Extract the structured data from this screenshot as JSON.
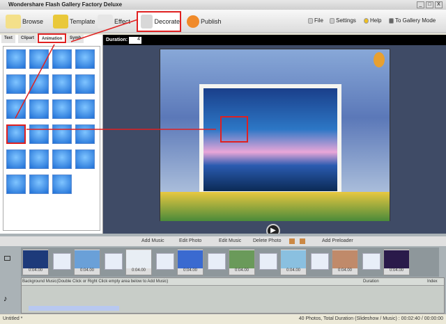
{
  "window": {
    "title": "Wondershare Flash Gallery Factory Deluxe",
    "min": "_",
    "max": "□",
    "close": "X"
  },
  "toolbar": {
    "browse": "Browse",
    "template": "Template",
    "effect": "Effect",
    "decorate": "Decorate",
    "publish": "Publish",
    "file": "File",
    "settings": "Settings",
    "help": "Help",
    "gallery": "To Gallery Mode"
  },
  "left_tabs": [
    "Text",
    "Clipart",
    "Animation",
    "Symb"
  ],
  "animation_count": 23,
  "duration": {
    "label": "Duration:",
    "value": "4"
  },
  "bottom_toolbar": {
    "add_music": "Add Music",
    "edit_photo": "Edit Photo",
    "edit_music": "Edit Music",
    "delete_photo": "Delete Photo",
    "add_preloader": "Add Preloader"
  },
  "film": {
    "time": "0:04.00",
    "photo_colors": [
      "#1d3a7a",
      "#6aa0d8",
      "#e8eef4",
      "#3a6ad0",
      "#6a9a5a",
      "#8ac0e0",
      "#c08a6a",
      "#2a1a4a"
    ]
  },
  "music": {
    "header": "Background Music(Double Click or Right Click empty area below to Add Music)",
    "duration": "Duration",
    "index": "Index"
  },
  "status": {
    "file": "Untitled *",
    "summary": "40 Photos, Total Duration (Slideshow / Music) : 00:02:40 / 00:00:00"
  }
}
